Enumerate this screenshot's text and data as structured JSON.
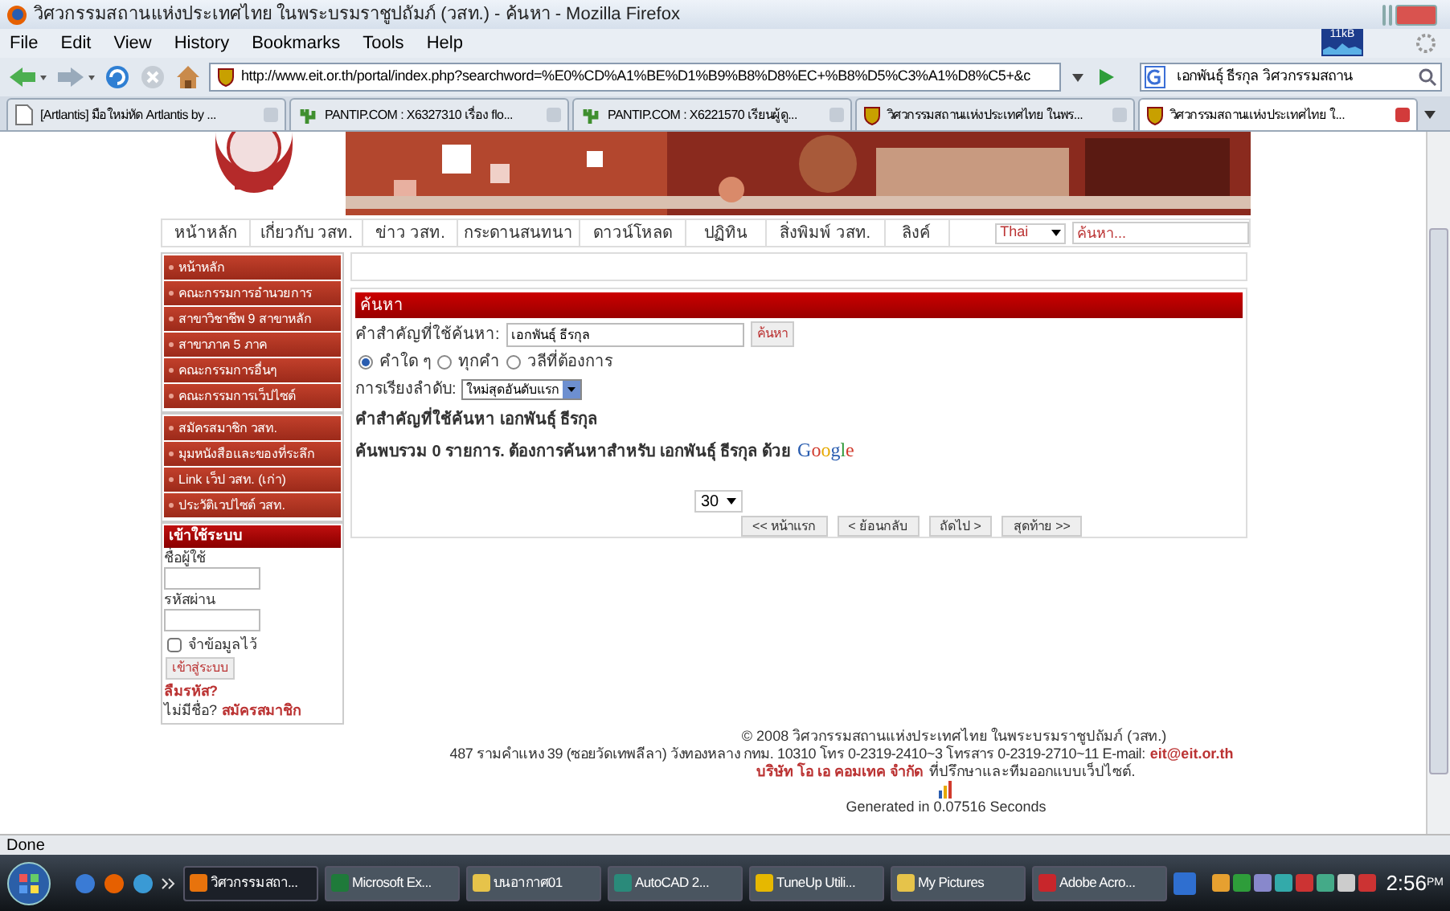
{
  "window": {
    "title": "วิศวกรรมสถานแห่งประเทศไทย ในพระบรมราชูปถัมภ์ (วสท.) - ค้นหา - Mozilla Firefox"
  },
  "menu": [
    "File",
    "Edit",
    "View",
    "History",
    "Bookmarks",
    "Tools",
    "Help"
  ],
  "toolbar": {
    "url": "http://www.eit.or.th/portal/index.php?searchword=%E0%CD%A1%BE%D1%B9%B8%D8%EC+%B8%D5%C3%A1%D8%C5+&c",
    "search_value": "เอกพันธุ์ ธีรกุล วิศวกรรมสถาน",
    "meter": "11kB"
  },
  "tabs": [
    {
      "label": "[Artlantis] มือใหม่หัด Artlantis by ...",
      "kind": "page",
      "selected": false
    },
    {
      "label": "PANTIP.COM : X6327310 เรื่อง flo...",
      "kind": "plant",
      "selected": false
    },
    {
      "label": "PANTIP.COM : X6221570 เรียนผู้ดู...",
      "kind": "plant",
      "selected": false
    },
    {
      "label": "วิศวกรรมสถานแห่งประเทศไทย ในพร...",
      "kind": "shield",
      "selected": false
    },
    {
      "label": "วิศวกรรมสถานแห่งประเทศไทย ใ...",
      "kind": "shield",
      "selected": true
    }
  ],
  "site": {
    "nav": [
      "หน้าหลัก",
      "เกี่ยวกับ วสท.",
      "ข่าว วสท.",
      "กระดานสนทนา",
      "ดาวน์โหลด",
      "ปฏิทิน",
      "สิ่งพิมพ์ วสท.",
      "ลิงค์"
    ],
    "language": "Thai",
    "search_placeholder": "ค้นหา...",
    "sidebar_groups": [
      [
        "หน้าหลัก",
        "คณะกรรมการอำนวยการ",
        "สาขาวิชาชีพ 9 สาขาหลัก",
        "สาขาภาค 5 ภาค",
        "คณะกรรมการอื่นๆ",
        "คณะกรรมการเว็ปไซต์"
      ],
      [
        "สมัครสมาชิก วสท.",
        "มุมหนังสือและของที่ระลึก",
        "Link เว็ป วสท. (เก่า)",
        "ประวัติเวปไซต์ วสท."
      ]
    ],
    "login": {
      "title": "เข้าใช้ระบบ",
      "username_label": "ชื่อผู้ใช้",
      "password_label": "รหัสผ่าน",
      "remember": {
        "label": "จำข้อมูลไว้",
        "checked": false
      },
      "button": "เข้าสู่ระบบ",
      "forgot": "ลืมรหัส?",
      "register_prompt": "ไม่มีชื่อ?",
      "register_link": "สมัครสมาชิก"
    },
    "search": {
      "title": "ค้นหา",
      "keyword_label": "คำสำคัญที่ใช้ค้นหา:",
      "keyword_value": "เอกพันธุ์ ธีรกุล",
      "button": "ค้นหา",
      "modes": [
        {
          "label": "คำใด ๆ",
          "selected": true
        },
        {
          "label": "ทุกคำ",
          "selected": false
        },
        {
          "label": "วลีที่ต้องการ",
          "selected": false
        }
      ],
      "sort_label": "การเรียงลำดับ:",
      "sort_value": "ใหม่สุดอันดับแรก",
      "result_title": "คำสำคัญที่ใช้ค้นหา เอกพันธุ์ ธีรกุล",
      "result_text": "ค้นพบรวม 0 รายการ. ต้องการค้นหาสำหรับ เอกพันธุ์ ธีรกุล ด้วย",
      "google": "Google",
      "per_page": "30",
      "pager": [
        "<< หน้าแรก",
        "< ย้อนกลับ",
        "ถัดไป >",
        "สุดท้าย >>"
      ]
    },
    "footer": {
      "copyright": "© 2008 วิศวกรรมสถานแห่งประเทศไทย ในพระบรมราชูปถัมภ์ (วสท.)",
      "address": "487 รามคำแหง 39 (ซอยวัดเทพลีลา) วังทองหลาง กทม. 10310 โทร 0-2319-2410~3 โทรสาร 0-2319-2710~11 E-mail:",
      "email": "eit@eit.or.th",
      "company": "บริษัท โอ เอ คอมเทค จำกัด",
      "company_note": "ที่ปรึกษาและทีมออกแบบเว็ปไซต์.",
      "generated": "Generated in 0.07516 Seconds"
    }
  },
  "status_bar": "Done",
  "taskbar": {
    "items": [
      {
        "label": "วิศวกรรมสถา...",
        "color": "#e8730c",
        "selected": true
      },
      {
        "label": "Microsoft Ex...",
        "color": "#1f7a3a",
        "selected": false
      },
      {
        "label": "บนอากาศ01",
        "color": "#e6c34a",
        "selected": false
      },
      {
        "label": "AutoCAD 2...",
        "color": "#2a8a7a",
        "selected": false
      },
      {
        "label": "TuneUp Utili...",
        "color": "#e6b800",
        "selected": false
      },
      {
        "label": "My Pictures",
        "color": "#e6c34a",
        "selected": false
      },
      {
        "label": "Adobe Acro...",
        "color": "#c8262b",
        "selected": false
      }
    ],
    "clock": "2:56",
    "clock_suffix": "PM"
  }
}
